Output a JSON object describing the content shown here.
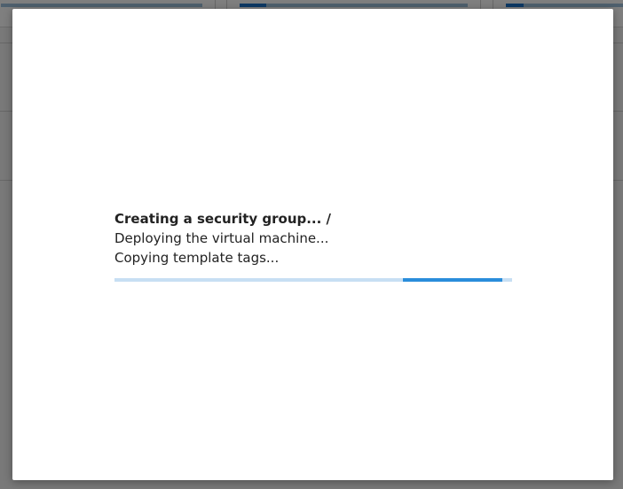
{
  "dialog": {
    "current_step": "Creating a security group... /",
    "steps": [
      "Deploying the virtual machine...",
      "Copying template tags..."
    ],
    "progress": {
      "state": "indeterminate",
      "segment_start_fraction": 0.725,
      "segment_end_fraction": 0.975
    }
  },
  "colors": {
    "overlay": "#7a7a7a",
    "dialog_bg": "#ffffff",
    "text": "#222222",
    "progress_track": "#c7dff3",
    "progress_fill": "#2a8ddb"
  }
}
